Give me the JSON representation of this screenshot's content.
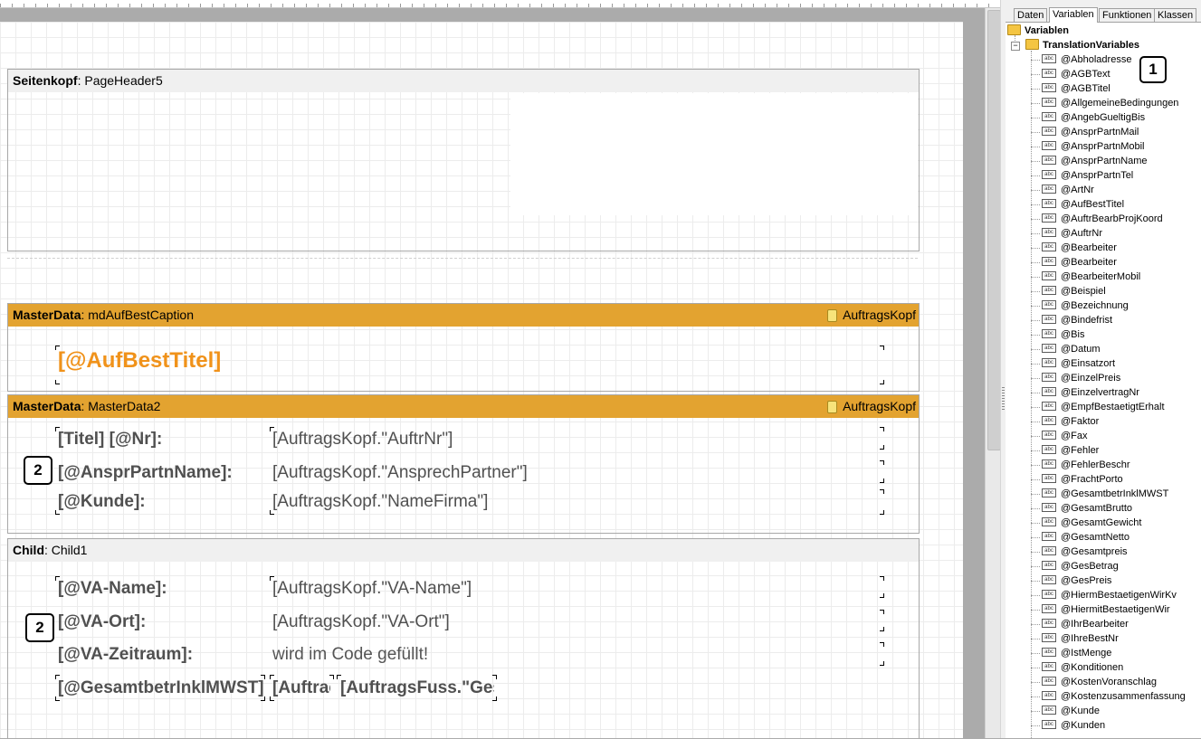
{
  "report": {
    "page_header": {
      "kind": "Seitenkopf",
      "name": "PageHeader5"
    },
    "master1": {
      "kind": "MasterData",
      "name": "mdAufBestCaption",
      "datasource": "AuftragsKopf",
      "title_field": "[@AufBestTitel]"
    },
    "master2": {
      "kind": "MasterData",
      "name": "MasterData2",
      "datasource": "AuftragsKopf",
      "rows": [
        {
          "label": "[Titel] [@Nr]:",
          "value": "[AuftragsKopf.\"AuftrNr\"]"
        },
        {
          "label": "[@AnsprPartnName]:",
          "value": "[AuftragsKopf.\"AnsprechPartner\"]"
        },
        {
          "label": "[@Kunde]:",
          "value": "[AuftragsKopf.\"NameFirma\"]"
        }
      ]
    },
    "child": {
      "kind": "Child",
      "name": "Child1",
      "rows": [
        {
          "label": "[@VA-Name]:",
          "value": "[AuftragsKopf.\"VA-Name\"]"
        },
        {
          "label": "[@VA-Ort]:",
          "value": "[AuftragsKopf.\"VA-Ort\"]"
        },
        {
          "label": "[@VA-Zeitraum]:",
          "value": "wird im Code gefüllt!"
        }
      ],
      "total_label": "[@GesamtbetrInklMWST]",
      "total_value1": "[Auftraç",
      "total_value2": "[AuftragsFuss.\"Ges"
    },
    "callouts": {
      "left": "2",
      "panel": "1"
    }
  },
  "panel": {
    "tabs": [
      "Daten",
      "Variablen",
      "Funktionen",
      "Klassen"
    ],
    "active_tab": "Variablen",
    "root": "Variablen",
    "group": "TranslationVariables",
    "variables": [
      "@Abholadresse",
      "@AGBText",
      "@AGBTitel",
      "@AllgemeineBedingungen",
      "@AngebGueltigBis",
      "@AnsprPartnMail",
      "@AnsprPartnMobil",
      "@AnsprPartnName",
      "@AnsprPartnTel",
      "@ArtNr",
      "@AufBestTitel",
      "@AuftrBearbProjKoord",
      "@AuftrNr",
      "@Bearbeiter",
      "@Bearbeiter",
      "@BearbeiterMobil",
      "@Beispiel",
      "@Bezeichnung",
      "@Bindefrist",
      "@Bis",
      "@Datum",
      "@Einsatzort",
      "@EinzelPreis",
      "@EinzelvertragNr",
      "@EmpfBestaetigtErhalt",
      "@Faktor",
      "@Fax",
      "@Fehler",
      "@FehlerBeschr",
      "@FrachtPorto",
      "@GesamtbetrInklMWST",
      "@GesamtBrutto",
      "@GesamtGewicht",
      "@GesamtNetto",
      "@Gesamtpreis",
      "@GesBetrag",
      "@GesPreis",
      "@HiermBestaetigenWirKv",
      "@HiermitBestaetigenWir",
      "@IhrBearbeiter",
      "@IhreBestNr",
      "@IstMenge",
      "@Konditionen",
      "@KostenVoranschlag",
      "@Kostenzusammenfassung",
      "@Kunde",
      "@Kunden"
    ]
  },
  "colors": {
    "band_orange": "#e3a330",
    "title_orange": "#f0921a"
  }
}
